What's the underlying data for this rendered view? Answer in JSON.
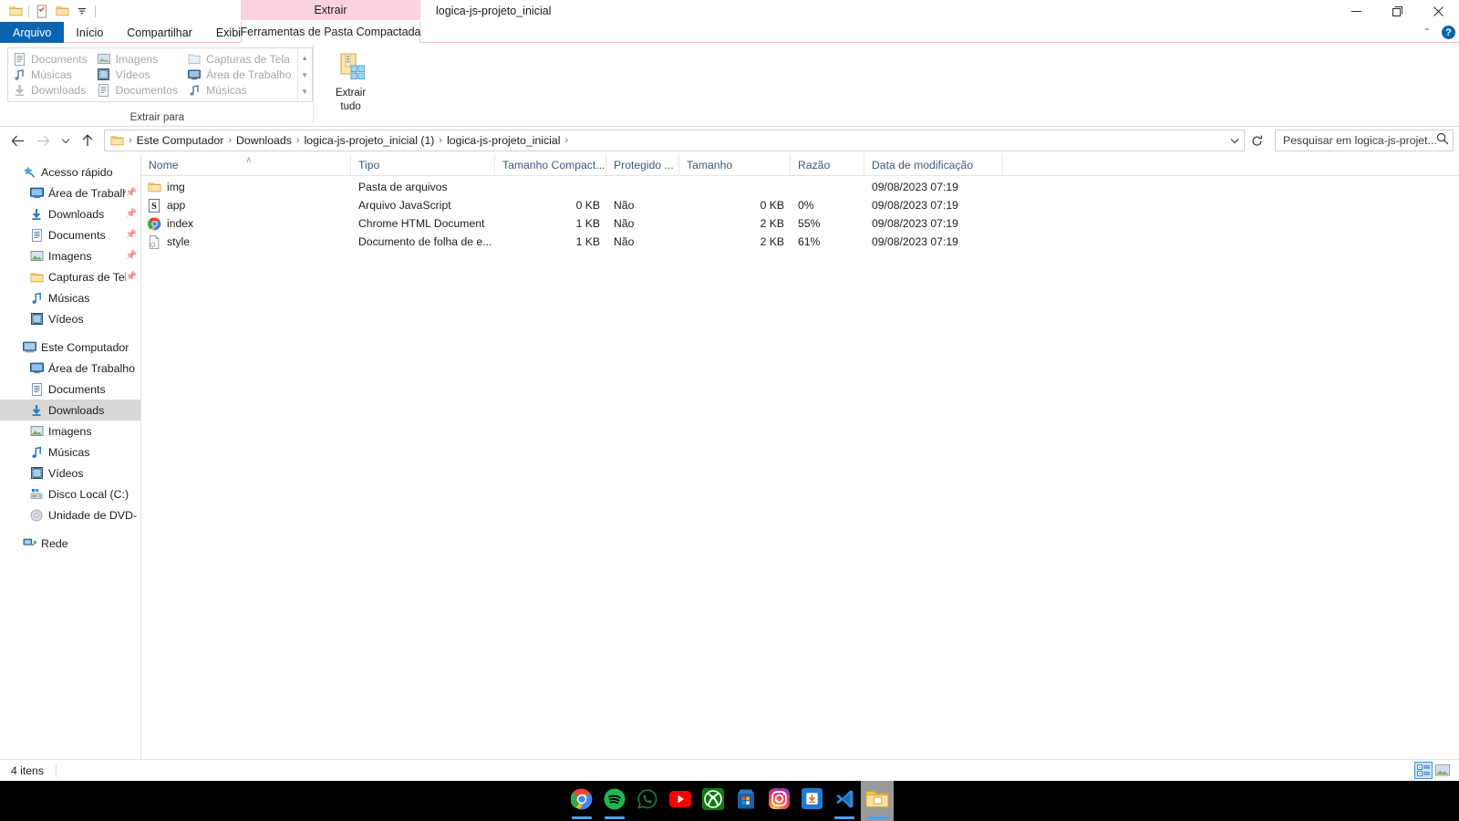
{
  "window": {
    "title": "logica-js-projeto_inicial",
    "contextual_tab_group": "Extrair",
    "minimize": "—",
    "maximize": "❐",
    "close": "✕"
  },
  "quick_access": {
    "items": [
      {
        "name": "folder-icon",
        "label": ""
      },
      {
        "name": "properties-icon",
        "label": ""
      },
      {
        "name": "new-folder-icon",
        "label": ""
      },
      {
        "name": "customize-dropdown-icon",
        "label": "▾"
      }
    ]
  },
  "ribbon": {
    "tabs": [
      {
        "id": "file",
        "label": "Arquivo"
      },
      {
        "id": "home",
        "label": "Início"
      },
      {
        "id": "share",
        "label": "Compartilhar"
      },
      {
        "id": "view",
        "label": "Exibir"
      }
    ],
    "contextual_tab": "Ferramentas de Pasta Compactada",
    "collapse_icon": "⌃",
    "help_icon": "?",
    "group_label": "Extrair para",
    "gallery": {
      "columns": [
        [
          {
            "label": "Documents",
            "icon": "documents-icon"
          },
          {
            "label": "Músicas",
            "icon": "music-icon"
          },
          {
            "label": "Downloads",
            "icon": "downloads-icon"
          }
        ],
        [
          {
            "label": "Imagens",
            "icon": "pictures-icon"
          },
          {
            "label": "Vídeos",
            "icon": "videos-icon"
          },
          {
            "label": "Documentos",
            "icon": "documents-icon"
          }
        ],
        [
          {
            "label": "Capturas de Tela",
            "icon": "folder-icon"
          },
          {
            "label": "Área de Trabalho",
            "icon": "desktop-icon"
          },
          {
            "label": "Músicas",
            "icon": "music-icon"
          }
        ]
      ],
      "scroll_up": "▲",
      "scroll_down": "▼",
      "scroll_more": "▼"
    },
    "extract_all": {
      "line1": "Extrair",
      "line2": "tudo"
    }
  },
  "address_bar": {
    "back": "←",
    "forward": "→",
    "recent": "⌄",
    "up": "↑",
    "breadcrumbs": [
      "Este Computador",
      "Downloads",
      "logica-js-projeto_inicial (1)",
      "logica-js-projeto_inicial"
    ],
    "separator": "›",
    "dropdown": "⌄",
    "refresh": "↻",
    "search_placeholder": "Pesquisar em logica-js-projet...",
    "search_value": ""
  },
  "nav_pane": {
    "groups": [
      {
        "header": {
          "label": "Acesso rápido",
          "icon": "star-pin-icon"
        },
        "items": [
          {
            "label": "Área de Trabalho",
            "icon": "desktop-icon",
            "pinned": true
          },
          {
            "label": "Downloads",
            "icon": "downloads-icon",
            "pinned": true
          },
          {
            "label": "Documents",
            "icon": "documents-icon",
            "pinned": true
          },
          {
            "label": "Imagens",
            "icon": "pictures-icon",
            "pinned": true
          },
          {
            "label": "Capturas de Tela",
            "icon": "folder-icon",
            "pinned": true
          },
          {
            "label": "Músicas",
            "icon": "music-icon",
            "pinned": false
          },
          {
            "label": "Vídeos",
            "icon": "videos-icon",
            "pinned": false
          }
        ]
      },
      {
        "header": {
          "label": "Este Computador",
          "icon": "computer-icon"
        },
        "items": [
          {
            "label": "Área de Trabalho",
            "icon": "desktop-icon",
            "pinned": false
          },
          {
            "label": "Documents",
            "icon": "documents-icon",
            "pinned": false
          },
          {
            "label": "Downloads",
            "icon": "downloads-icon",
            "pinned": false,
            "selected": true
          },
          {
            "label": "Imagens",
            "icon": "pictures-icon",
            "pinned": false
          },
          {
            "label": "Músicas",
            "icon": "music-icon",
            "pinned": false
          },
          {
            "label": "Vídeos",
            "icon": "videos-icon",
            "pinned": false
          },
          {
            "label": "Disco Local (C:)",
            "icon": "drive-icon",
            "pinned": false
          },
          {
            "label": "Unidade de DVD-RW",
            "icon": "dvd-icon",
            "pinned": false
          }
        ]
      },
      {
        "header": {
          "label": "Rede",
          "icon": "network-icon"
        },
        "items": []
      }
    ]
  },
  "file_list": {
    "columns": [
      {
        "key": "name",
        "label": "Nome",
        "sorted": true,
        "sort_glyph": "∧"
      },
      {
        "key": "type",
        "label": "Tipo"
      },
      {
        "key": "packed",
        "label": "Tamanho Compact..."
      },
      {
        "key": "protected",
        "label": "Protegido ..."
      },
      {
        "key": "size",
        "label": "Tamanho"
      },
      {
        "key": "ratio",
        "label": "Razão"
      },
      {
        "key": "modified",
        "label": "Data de modificação"
      }
    ],
    "rows": [
      {
        "icon": "folder-icon",
        "name": "img",
        "type": "Pasta de arquivos",
        "packed": "",
        "protected": "",
        "size": "",
        "ratio": "",
        "modified": "09/08/2023 07:19"
      },
      {
        "icon": "javascript-file-icon",
        "name": "app",
        "type": "Arquivo JavaScript",
        "packed": "0 KB",
        "protected": "Não",
        "size": "0 KB",
        "ratio": "0%",
        "modified": "09/08/2023 07:19"
      },
      {
        "icon": "chrome-html-icon",
        "name": "index",
        "type": "Chrome HTML Document",
        "packed": "1 KB",
        "protected": "Não",
        "size": "2 KB",
        "ratio": "55%",
        "modified": "09/08/2023 07:19"
      },
      {
        "icon": "css-file-icon",
        "name": "style",
        "type": "Documento de folha de e...",
        "packed": "1 KB",
        "protected": "Não",
        "size": "2 KB",
        "ratio": "61%",
        "modified": "09/08/2023 07:19"
      }
    ]
  },
  "status_bar": {
    "item_count": "4 itens",
    "view_details": "details-view",
    "view_large_icons": "large-icons-view"
  },
  "taskbar": {
    "items": [
      {
        "name": "chrome",
        "running": true,
        "active": false
      },
      {
        "name": "spotify",
        "running": true,
        "active": false
      },
      {
        "name": "whatsapp",
        "running": false,
        "active": false
      },
      {
        "name": "youtube",
        "running": false,
        "active": false
      },
      {
        "name": "xbox",
        "running": false,
        "active": false
      },
      {
        "name": "microsoft-store",
        "running": false,
        "active": false
      },
      {
        "name": "instagram",
        "running": false,
        "active": false
      },
      {
        "name": "app-installer",
        "running": false,
        "active": false
      },
      {
        "name": "vscode",
        "running": true,
        "active": false
      },
      {
        "name": "file-explorer",
        "running": true,
        "active": true
      }
    ]
  },
  "colors": {
    "accent": "#0a64b0",
    "contextual_tab": "#fcd2e2",
    "selection": "#d8d8d8",
    "column_header_text": "#3a5a7a"
  }
}
